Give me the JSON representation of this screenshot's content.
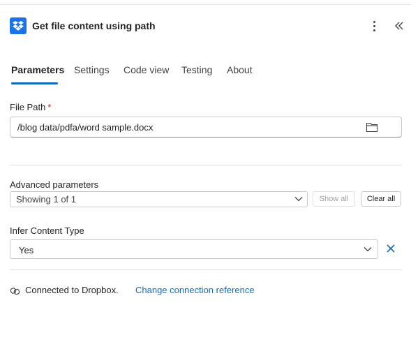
{
  "header": {
    "title": "Get file content using path",
    "app_icon": "dropbox-icon",
    "more_icon": "more-vertical-icon",
    "collapse_icon": "double-chevron-left-icon"
  },
  "tabs": [
    {
      "label": "Parameters",
      "active": true
    },
    {
      "label": "Settings",
      "active": false
    },
    {
      "label": "Code view",
      "active": false
    },
    {
      "label": "Testing",
      "active": false
    },
    {
      "label": "About",
      "active": false
    }
  ],
  "file_path": {
    "label": "File Path",
    "required_marker": "*",
    "value": "/blog data/pdfa/word sample.docx",
    "icon": "folder-icon"
  },
  "advanced": {
    "label": "Advanced parameters",
    "selected": "Showing 1 of 1",
    "show_all_label": "Show all",
    "clear_all_label": "Clear all"
  },
  "infer": {
    "label": "Infer Content Type",
    "selected": "Yes",
    "clear_icon": "close-icon"
  },
  "connection": {
    "text": "Connected to Dropbox.",
    "link": "Change connection reference",
    "icon": "link-icon"
  },
  "colors": {
    "accent": "#0f6cbd",
    "dropbox": "#1a73e8",
    "required": "#c50f1f"
  }
}
